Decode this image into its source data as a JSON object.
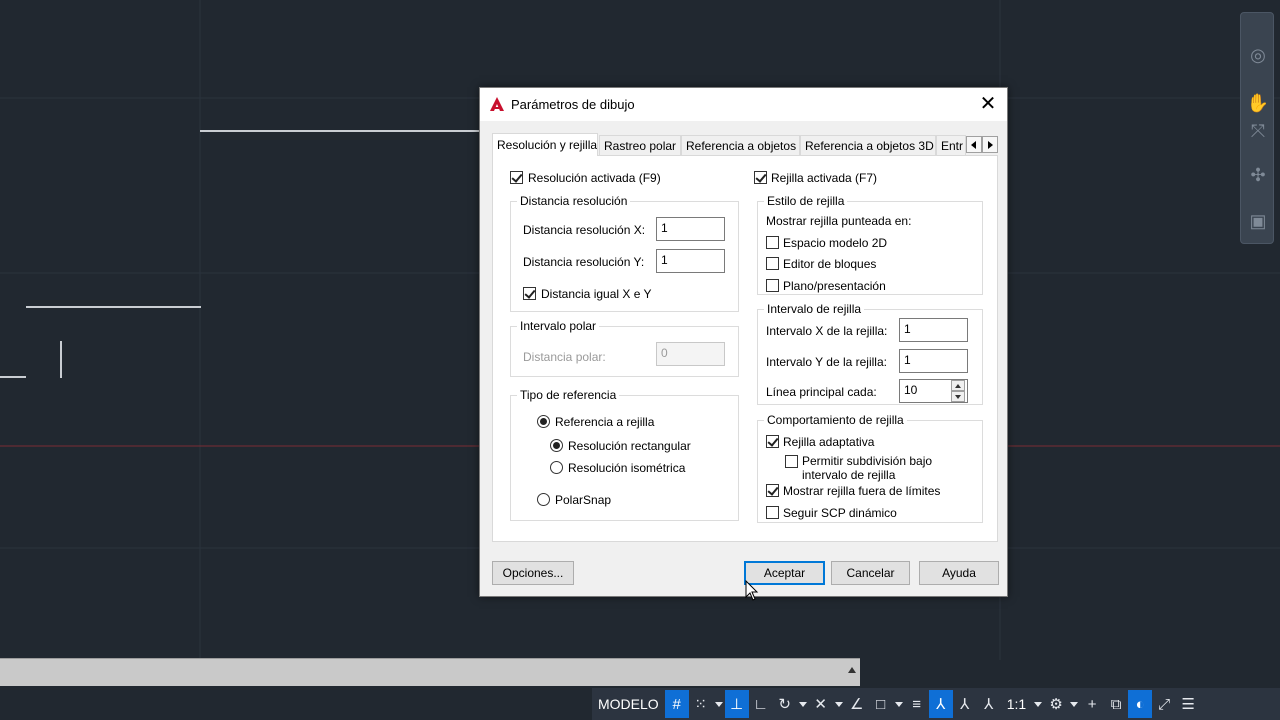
{
  "dialog": {
    "title": "Parámetros de dibujo",
    "close_icon": "close-icon",
    "tabs": [
      "Resolución y rejilla",
      "Rastreo polar",
      "Referencia a objetos",
      "Referencia a objetos 3D",
      "Entr"
    ],
    "selected_tab": "Resolución y rejilla"
  },
  "snap": {
    "on_label": "Resolución activada (F9)",
    "on": true,
    "spacing_group": "Distancia resolución",
    "x_label": "Distancia resolución X:",
    "x_value": "1",
    "y_label": "Distancia resolución Y:",
    "y_value": "1",
    "equal_label": "Distancia igual X e Y",
    "equal": true,
    "polar_group": "Intervalo polar",
    "polar_label": "Distancia polar:",
    "polar_value": "0",
    "type_group": "Tipo de referencia",
    "grid_snap_label": "Referencia a rejilla",
    "rect_label": "Resolución rectangular",
    "iso_label": "Resolución isométrica",
    "polarsnap_label": "PolarSnap"
  },
  "grid": {
    "on_label": "Rejilla activada (F7)",
    "on": true,
    "style_group": "Estilo de rejilla",
    "dotted_label": "Mostrar rejilla punteada en:",
    "model2d_label": "Espacio modelo 2D",
    "block_editor_label": "Editor de bloques",
    "layout_label": "Plano/presentación",
    "spacing_group": "Intervalo de rejilla",
    "x_label": "Intervalo X de la rejilla:",
    "x_value": "1",
    "y_label": "Intervalo Y de la rejilla:",
    "y_value": "1",
    "major_label": "Línea principal cada:",
    "major_value": "10",
    "behavior_group": "Comportamiento de rejilla",
    "adaptive_label": "Rejilla adaptativa",
    "subdivide_label_1": "Permitir subdivisión bajo",
    "subdivide_label_2": "intervalo de rejilla",
    "beyond_label": "Mostrar rejilla fuera de límites",
    "follow_ucs_label": "Seguir SCP dinámico"
  },
  "buttons": {
    "options": "Opciones...",
    "ok": "Aceptar",
    "cancel": "Cancelar",
    "help": "Ayuda"
  },
  "statusbar": {
    "model": "MODELO",
    "scale": "1:1"
  },
  "colors": {
    "canvas": "#212830",
    "accent": "#0078d7",
    "app_logo": "#c8102e"
  }
}
